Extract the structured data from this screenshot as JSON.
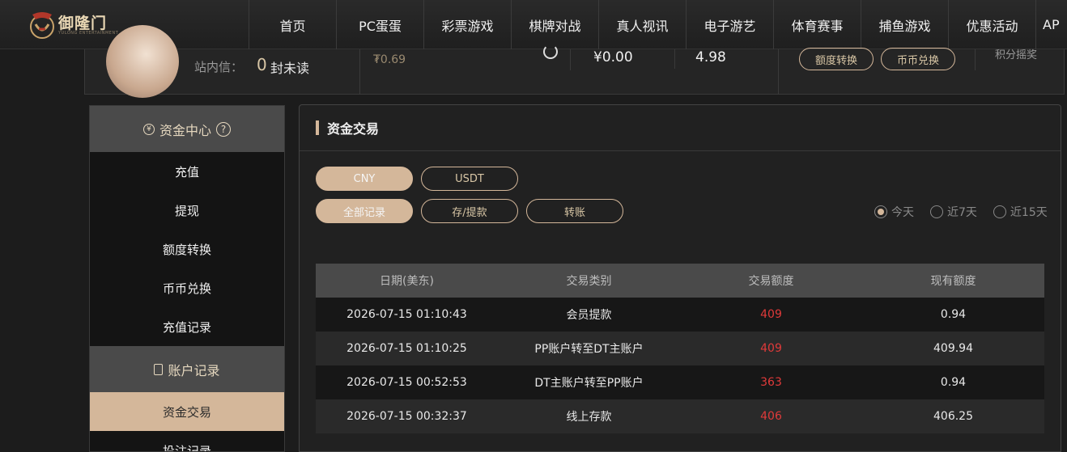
{
  "brand": {
    "name": "御隆门",
    "sub": "YULONG ENTERTAINMENT"
  },
  "nav": [
    "首页",
    "PC蛋蛋",
    "彩票游戏",
    "棋牌对战",
    "真人视讯",
    "电子游艺",
    "体育赛事",
    "捕鱼游戏",
    "优惠活动",
    "AP"
  ],
  "user": {
    "msg_label": "站内信：",
    "msg_count": "0",
    "msg_unit": "封未读",
    "balance_small": "₮0.69",
    "balance_main": "¥0.00",
    "balance_2": "4.98",
    "btn_quota": "额度转换",
    "btn_exchange": "币币兑换",
    "extra": "积分摇奖"
  },
  "sidebar": {
    "group1": "资金中心",
    "group1_icon": "coin-icon",
    "items1": [
      "充值",
      "提现",
      "额度转换",
      "币币兑换",
      "充值记录"
    ],
    "group2": "账户记录",
    "items2": [
      "资金交易",
      "投注记录"
    ],
    "active": "资金交易"
  },
  "panel": {
    "title": "资金交易",
    "currency_tabs": [
      "CNY",
      "USDT"
    ],
    "record_tabs": [
      "全部记录",
      "存/提款",
      "转账"
    ],
    "ranges": [
      "今天",
      "近7天",
      "近15天"
    ],
    "accent": "#d4b79a",
    "amount_color": "#e03a3a"
  },
  "table": {
    "headers": [
      "日期(美东)",
      "交易类别",
      "交易额度",
      "现有额度"
    ],
    "rows": [
      [
        "2026-07-15 01:10:43",
        "会员提款",
        "409",
        "0.94"
      ],
      [
        "2026-07-15 01:10:25",
        "PP账户转至DT主账户",
        "409",
        "409.94"
      ],
      [
        "2026-07-15 00:52:53",
        "DT主账户转至PP账户",
        "363",
        "0.94"
      ],
      [
        "2026-07-15 00:32:37",
        "线上存款",
        "406",
        "406.25"
      ]
    ]
  }
}
